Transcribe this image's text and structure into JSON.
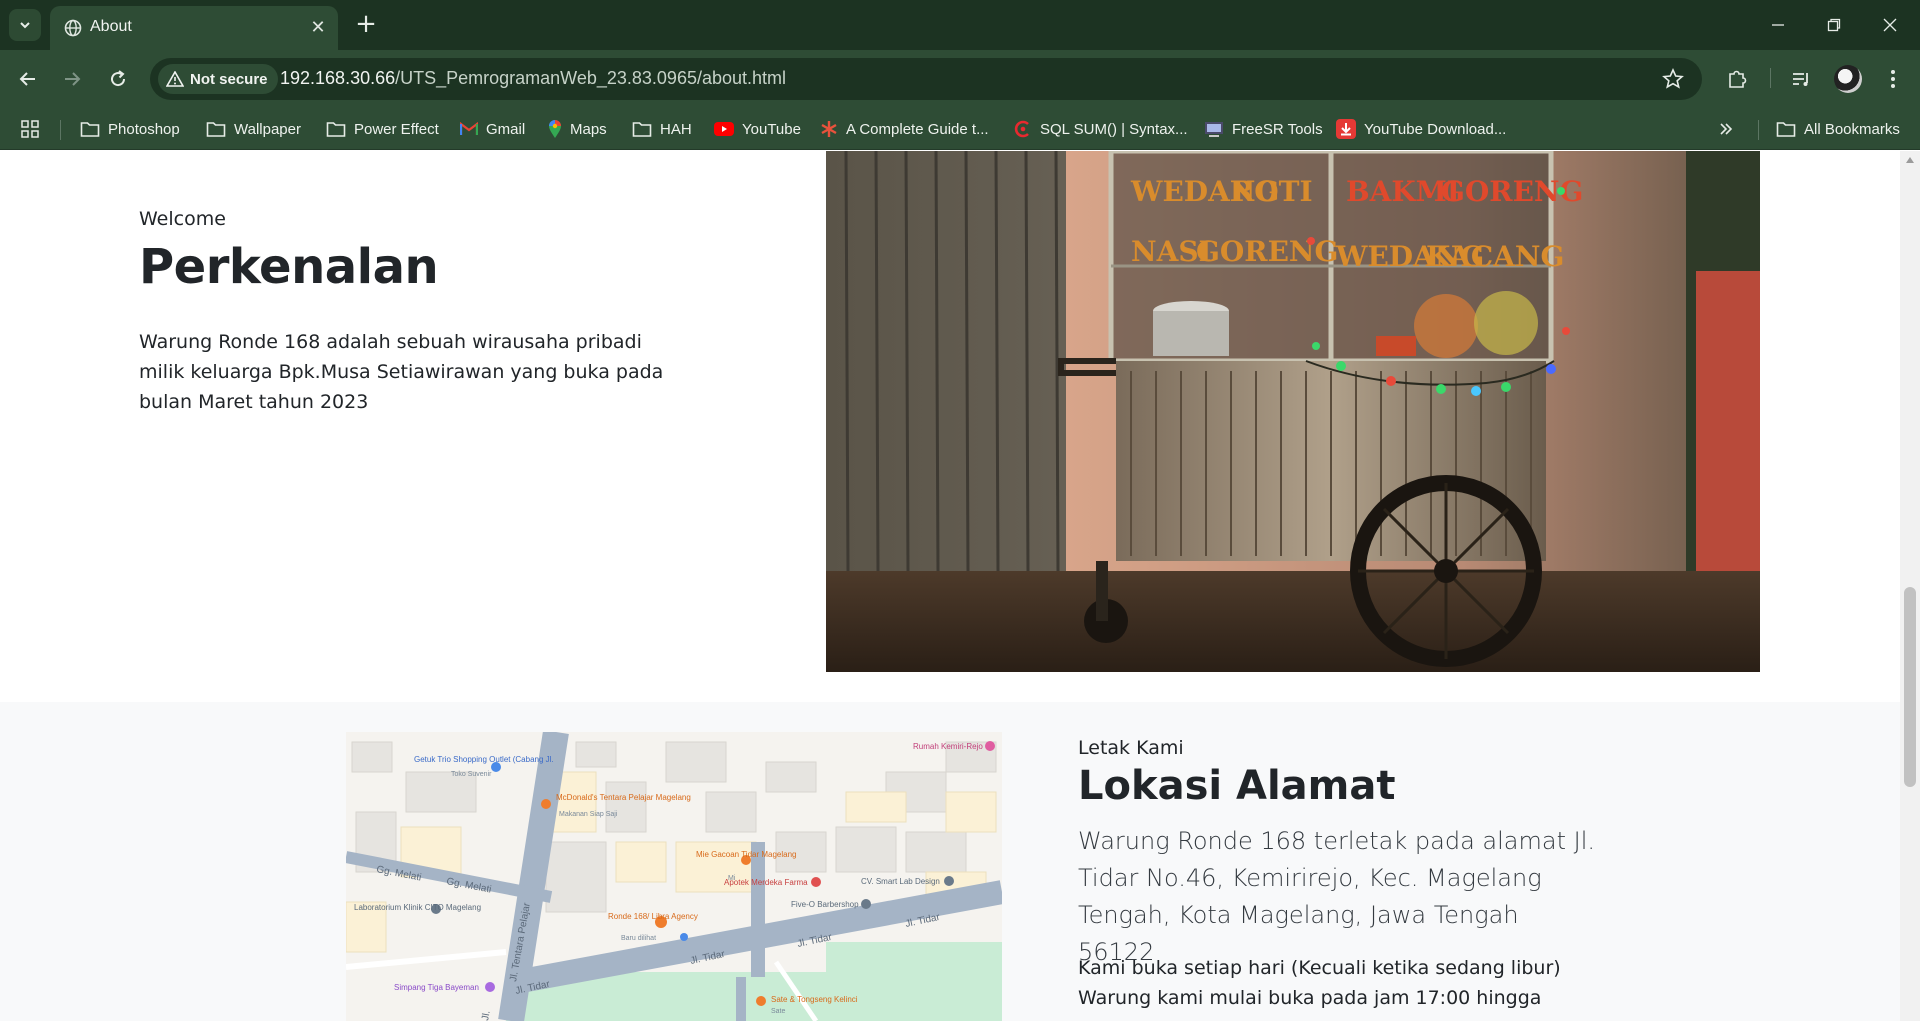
{
  "browser": {
    "tab_title": "About",
    "security_label": "Not secure",
    "url_host": "192.168.30.66",
    "url_path": "/UTS_PemrogramanWeb_23.83.0965/about.html",
    "bookmarks": [
      {
        "label": "Photoshop",
        "icon": "folder-icon"
      },
      {
        "label": "Wallpaper",
        "icon": "folder-icon"
      },
      {
        "label": "Power Effect",
        "icon": "folder-icon"
      },
      {
        "label": "Gmail",
        "icon": "gmail-icon"
      },
      {
        "label": "Maps",
        "icon": "maps-icon"
      },
      {
        "label": "HAH",
        "icon": "folder-icon"
      },
      {
        "label": "YouTube",
        "icon": "youtube-icon"
      },
      {
        "label": "A Complete Guide t...",
        "icon": "asterisk-icon"
      },
      {
        "label": "SQL SUM() | Syntax...",
        "icon": "sql-icon"
      },
      {
        "label": "FreeSR Tools",
        "icon": "freesr-icon"
      },
      {
        "label": "YouTube Download...",
        "icon": "download-icon"
      }
    ],
    "all_bookmarks_label": "All Bookmarks",
    "colors": {
      "frame": "#1c3322",
      "toolbar": "#2e4c35"
    }
  },
  "intro": {
    "subtitle": "Welcome",
    "title": "Perkenalan",
    "text": "Warung Ronde 168 adalah sebuah wirausaha pribadi milik keluarga Bpk.Musa Setiawirawan yang buka pada bulan Maret tahun 2023"
  },
  "photo": {
    "cart_signs": [
      "WEDANG",
      "ROTI",
      "BAKMI",
      "GORENG",
      "NASI",
      "GORENG",
      "WEDANG",
      "KACANG"
    ]
  },
  "location": {
    "subtitle": "Letak Kami",
    "title": "Lokasi Alamat",
    "lead": "Warung Ronde 168 terletak pada alamat Jl. Tidar No.46, Kemirirejo, Kec. Magelang Tengah, Kota Magelang, Jawa Tengah 56122",
    "hours_line1": "Kami buka setiap hari (Kecuali ketika sedang libur)",
    "hours_line2": "Warung kami mulai buka pada jam 17:00 hingga"
  },
  "map": {
    "labels": {
      "rumah": "Rumah Kemiri-Rejo",
      "getuk": "Getuk Trio Shopping Outlet (Cabang Jl.",
      "getuk_sub": "Toko Suvenir",
      "mcd": "McDonald's Tentara Pelajar Magelang",
      "mcd_sub": "Makanan Siap Saji",
      "gacoan": "Mie Gacoan Tidar Magelang",
      "gacoan_sub": "Mi",
      "apotek": "Apotek Merdeka Farma",
      "cv": "CV. Smart Lab Design",
      "fivee": "Five-O Barbershop",
      "lab": "Laboratorium Klinik CITO Magelang",
      "ronde": "Ronde 168/ Libra Agency",
      "ronde_sub": "Baru dilihat",
      "simpang": "Simpang Tiga Bayeman",
      "sate": "Sate & Tongseng Kelinci",
      "sate_sub": "Sate",
      "jl_tidar_1": "Jl. Tidar",
      "jl_tidar_2": "Jl. Tidar",
      "jl_tidar_3": "Jl. Tidar",
      "jl_tidar_4": "Jl. Tidar",
      "gg_melati_1": "Gg. Melati",
      "gg_melati_2": "Gg. Melati",
      "jl_tentara": "Jl. Tentara Pelajar",
      "jl_bottom": "Jl."
    }
  }
}
